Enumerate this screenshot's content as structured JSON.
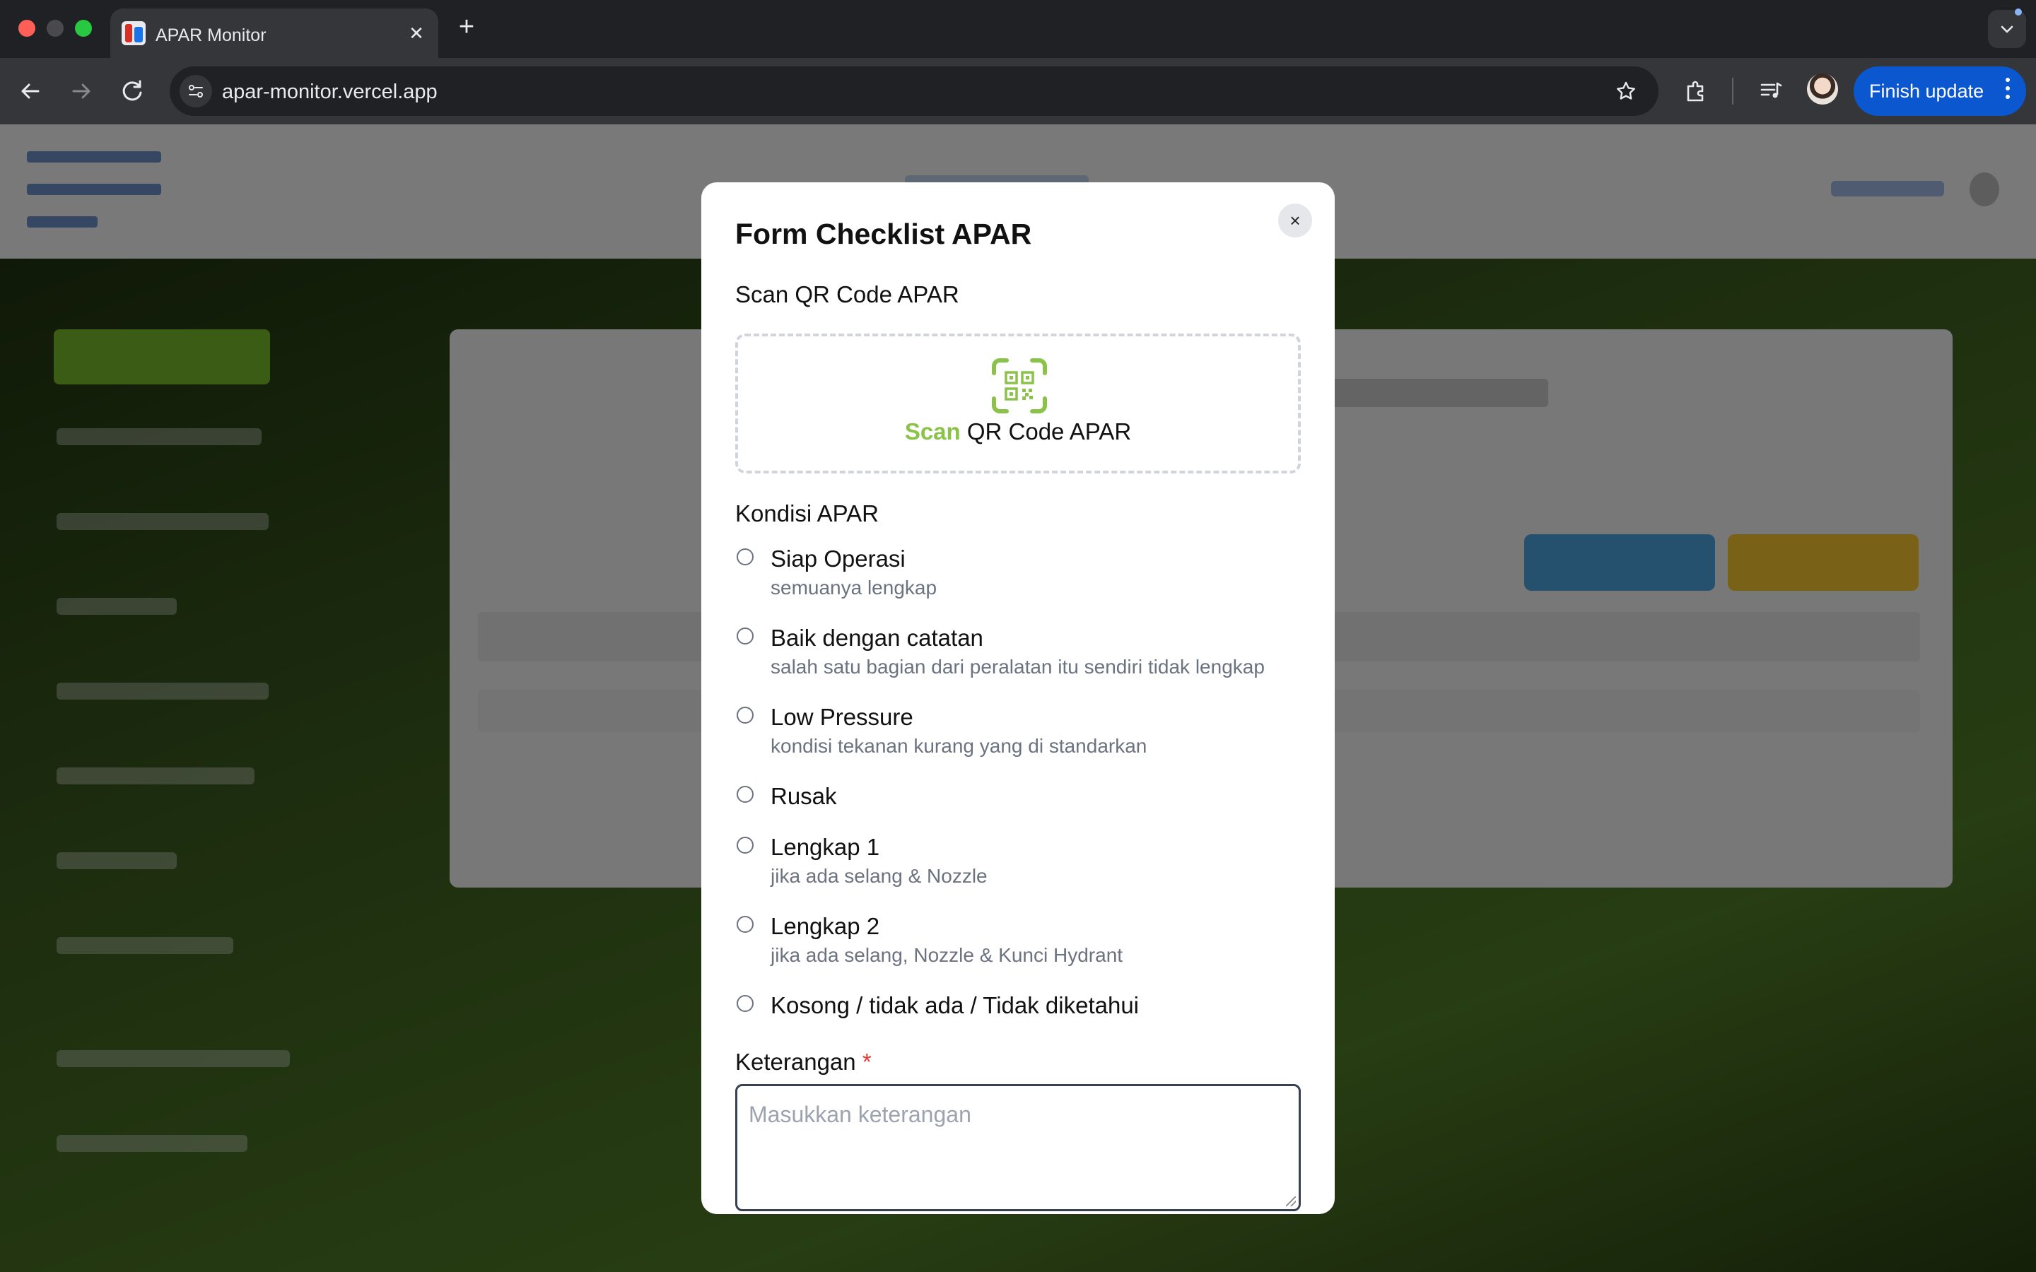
{
  "browser": {
    "tab_title": "APAR Monitor",
    "url": "apar-monitor.vercel.app",
    "finish_update_label": "Finish update",
    "icons": [
      "back-arrow-icon",
      "forward-arrow-icon",
      "reload-icon",
      "site-info-icon",
      "star-icon",
      "extensions-icon",
      "media-icon",
      "chevron-down-icon",
      "close-icon",
      "plus-icon"
    ]
  },
  "modal": {
    "title": "Form Checklist APAR",
    "close_symbol": "×",
    "scan_section_label": "Scan QR Code APAR",
    "scan_button": {
      "accent_word": "Scan",
      "rest_text": " QR Code APAR",
      "accent_color": "#8bc34a",
      "icon": "qr-code-icon"
    },
    "kondisi_label": "Kondisi APAR",
    "options": [
      {
        "label": "Siap Operasi",
        "desc": "semuanya lengkap",
        "selected": false
      },
      {
        "label": "Baik dengan catatan",
        "desc": "salah satu bagian dari peralatan itu sendiri tidak lengkap",
        "selected": false
      },
      {
        "label": "Low Pressure",
        "desc": "kondisi tekanan kurang yang di standarkan",
        "selected": false
      },
      {
        "label": "Rusak",
        "desc": "",
        "selected": false
      },
      {
        "label": "Lengkap 1",
        "desc": "jika ada selang & Nozzle",
        "selected": false
      },
      {
        "label": "Lengkap 2",
        "desc": "jika ada selang, Nozzle & Kunci Hydrant",
        "selected": false
      },
      {
        "label": "Kosong / tidak ada / Tidak diketahui",
        "desc": "",
        "selected": false
      }
    ],
    "keterangan_label": "Keterangan",
    "required_mark": "*",
    "keterangan_placeholder": "Masukkan keterangan",
    "keterangan_value": ""
  }
}
